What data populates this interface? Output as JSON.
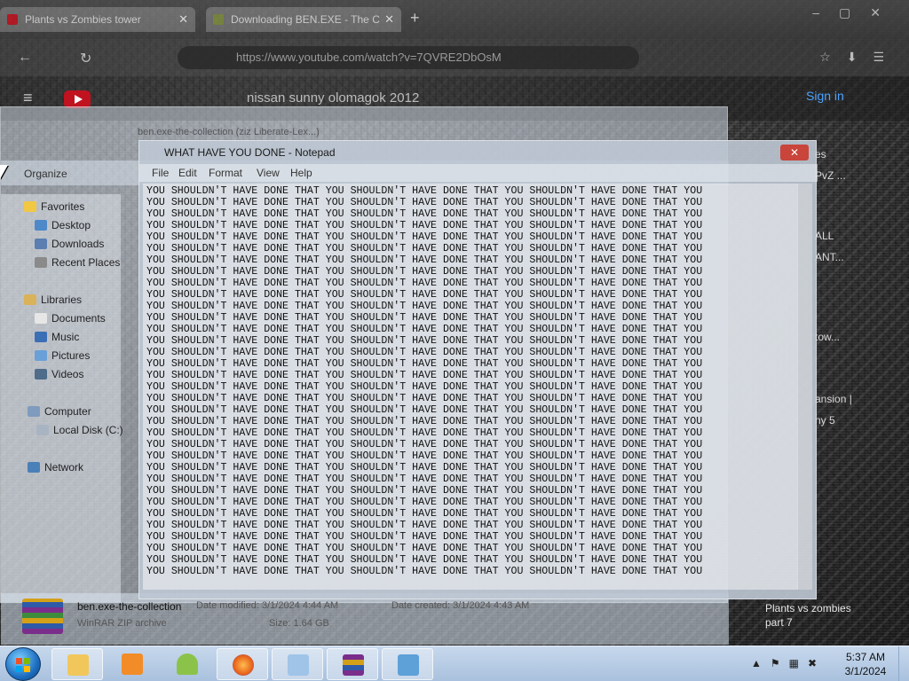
{
  "browser": {
    "tabs": [
      {
        "title": "Plants vs Zombies tower",
        "favicon_color": "#c1121f"
      },
      {
        "title": "Downloading BEN.EXE - The C",
        "favicon_color": "#7a8a3a"
      }
    ],
    "url": "https://www.youtube.com/watch?v=7QVRE2DbOsM",
    "youtube": {
      "search_text": "nissan sunny olomagok 2012",
      "signin_label": "Sign in",
      "side_items": [
        "es",
        "PvZ ...",
        "ALL",
        "ANT...",
        "tow...",
        "ansion |",
        "ny 5"
      ],
      "suggested_title": "Plants vs zombies part 7"
    }
  },
  "explorer": {
    "title_partial": "ben.exe-the-collection (ziz Liberate-Lex...)",
    "organize_label": "Organize",
    "nav": {
      "favorites": "Favorites",
      "desktop": "Desktop",
      "downloads": "Downloads",
      "recent": "Recent Places",
      "libraries": "Libraries",
      "documents": "Documents",
      "music": "Music",
      "pictures": "Pictures",
      "videos": "Videos",
      "computer": "Computer",
      "local_disk": "Local Disk (C:)",
      "network": "Network"
    },
    "status": {
      "file_name": "ben.exe-the-collection",
      "date_modified": "Date modified: 3/1/2024 4:44 AM",
      "date_created": "Date created: 3/1/2024 4:43 AM",
      "type": "WinRAR ZIP archive",
      "size": "Size: 1.64 GB"
    }
  },
  "notepad": {
    "title": "WHAT HAVE YOU DONE - Notepad",
    "close_label": "✕",
    "menu": [
      "File",
      "Edit",
      "Format",
      "View",
      "Help"
    ],
    "text_line": "YOU SHOULDN'T HAVE DONE THAT YOU SHOULDN'T HAVE DONE THAT YOU SHOULDN'T HAVE DONE THAT YOU",
    "line_count": 34
  },
  "taskbar": {
    "time": "5:37 AM",
    "date": "3/1/2024",
    "apps": [
      {
        "name": "explorer",
        "color": "#f1c75b"
      },
      {
        "name": "media-player",
        "color": "#f28c28"
      },
      {
        "name": "android",
        "color": "#8bc34a"
      },
      {
        "name": "firefox",
        "color": "#e8641b"
      },
      {
        "name": "notepad-files",
        "color": "#9fc4e8"
      },
      {
        "name": "winrar",
        "color": "#7b2d8c"
      },
      {
        "name": "notepad",
        "color": "#5ea0d8"
      }
    ]
  }
}
